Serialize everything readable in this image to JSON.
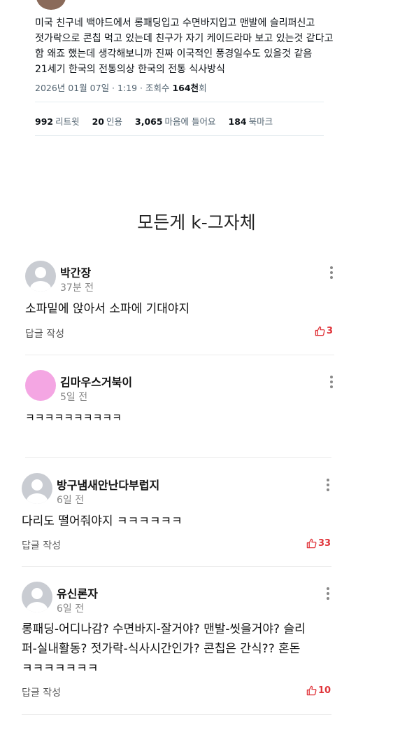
{
  "tweet": {
    "lines": [
      "미국 친구네 백야드에서 롱패딩입고 수면바지입고 맨발에 슬리퍼신고",
      "젓가락으로 콘칩 먹고 있는데 친구가 자기 케이드라마 보고 있는것 같다고",
      "함 왜죠 했는데 생각해보니까 진짜 이국적인 풍경일수도 있을것 같음",
      "21세기 한국의 전통의상 한국의 전통 식사방식"
    ],
    "meta_date": "2026년 01월 07일 · 1:19 · 조회수 ",
    "meta_views": "164천",
    "meta_suffix": "회",
    "stats": [
      {
        "num": "992",
        "label": "리트윗"
      },
      {
        "num": "20",
        "label": "인용"
      },
      {
        "num": "3,065",
        "label": "마음에 들어요"
      },
      {
        "num": "184",
        "label": "북마크"
      }
    ]
  },
  "caption": "모든게 k-그자체",
  "comments": [
    {
      "nick": "박간장",
      "time": "37분 전",
      "lines": [
        "소파밑에 앉아서 소파에 기대야지"
      ],
      "reply": "답글 작성",
      "likes": "3",
      "avatar": "default-gray"
    },
    {
      "nick": "김마우스거북이",
      "time": "5일 전",
      "lines": [
        "ㅋㅋㅋㅋㅋㅋㅋㅋㅋㅋ"
      ],
      "reply": "",
      "likes": "",
      "avatar": "pink"
    },
    {
      "nick": "방구냄새안난다부럽지",
      "time": "6일 전",
      "lines": [
        "다리도 떨어줘야지 ㅋㅋㅋㅋㅋㅋ"
      ],
      "reply": "답글 작성",
      "likes": "33",
      "avatar": "default-gray"
    },
    {
      "nick": "유신론자",
      "time": "6일 전",
      "lines": [
        "롱패딩-어디나감? 수면바지-잘거야? 맨발-씻을거야? 슬리",
        "퍼-실내활동? 젓가락-식사시간인가? 콘칩은 간식?? 혼돈",
        "ㅋㅋㅋㅋㅋㅋㅋ"
      ],
      "reply": "답글 작성",
      "likes": "10",
      "avatar": "default-gray"
    }
  ],
  "colors": {
    "like": "#e0343a",
    "avatar_gray": "#c9ccd2",
    "avatar_pink": "#f4a6e3"
  }
}
